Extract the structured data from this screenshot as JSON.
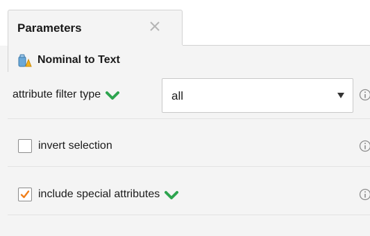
{
  "tab": {
    "title": "Parameters",
    "close_icon": "close-icon"
  },
  "operator": {
    "name": "Nominal to Text",
    "icon": "operator-icon"
  },
  "parameters": {
    "attribute_filter_type": {
      "label": "attribute filter type",
      "value": "all",
      "expert_indicator": "check-icon"
    },
    "invert_selection": {
      "label": "invert selection",
      "checked": false
    },
    "include_special_attributes": {
      "label": "include special attributes",
      "checked": true,
      "expert_indicator": "check-icon"
    },
    "info_icon": "info-icon"
  },
  "colors": {
    "check_green": "#2ea44f",
    "checkbox_orange": "#f07f1a",
    "info_gray": "#8c8c8c"
  }
}
